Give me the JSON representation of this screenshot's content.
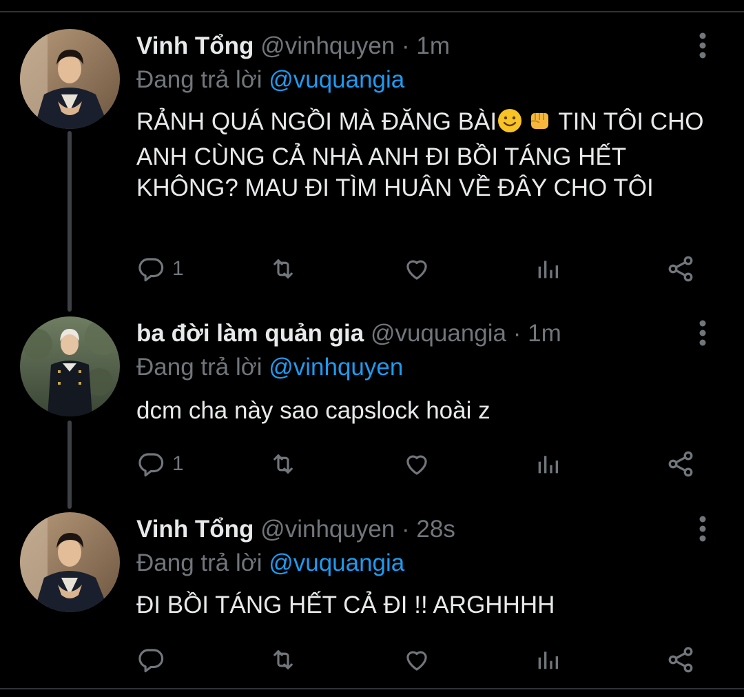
{
  "colors": {
    "background": "#000000",
    "text": "#e7e9ea",
    "secondary": "#71767b",
    "accent": "#1d9bf0",
    "thread_line": "#3d4145"
  },
  "tweets": [
    {
      "display_name": "Vinh Tổng",
      "handle": "@vinhquyen",
      "separator": "·",
      "time": "1m",
      "reply_prefix": "Đang trả lời",
      "reply_to": "@vuquangia",
      "text_before_emoji": "RẢNH QUÁ NGỒI MÀ ĐĂNG BÀI",
      "emojis": [
        "slightly-smiling-face",
        "oncoming-fist"
      ],
      "text_after_emoji": " TIN TÔI CHO ANH CÙNG CẢ NHÀ ANH ĐI BỒI TÁNG HẾT KHÔNG? MAU ĐI TÌM HUÂN VỀ ĐÂY CHO TÔI",
      "reply_count": "1"
    },
    {
      "display_name": "ba đời làm quản gia",
      "handle": "@vuquangia",
      "separator": "·",
      "time": "1m",
      "reply_prefix": "Đang trả lời",
      "reply_to": "@vinhquyen",
      "text": "dcm cha này sao capslock hoài z",
      "reply_count": "1"
    },
    {
      "display_name": "Vinh Tổng",
      "handle": "@vinhquyen",
      "separator": "·",
      "time": "28s",
      "reply_prefix": "Đang trả lời",
      "reply_to": "@vuquangia",
      "text": "ĐI BỒI TÁNG HẾT CẢ ĐI !! ARGHHHH",
      "reply_count": ""
    }
  ],
  "icons": {
    "reply": "reply-icon",
    "retweet": "retweet-icon",
    "like": "heart-icon",
    "views": "analytics-icon",
    "share": "share-icon",
    "more": "more-vertical-icon"
  }
}
